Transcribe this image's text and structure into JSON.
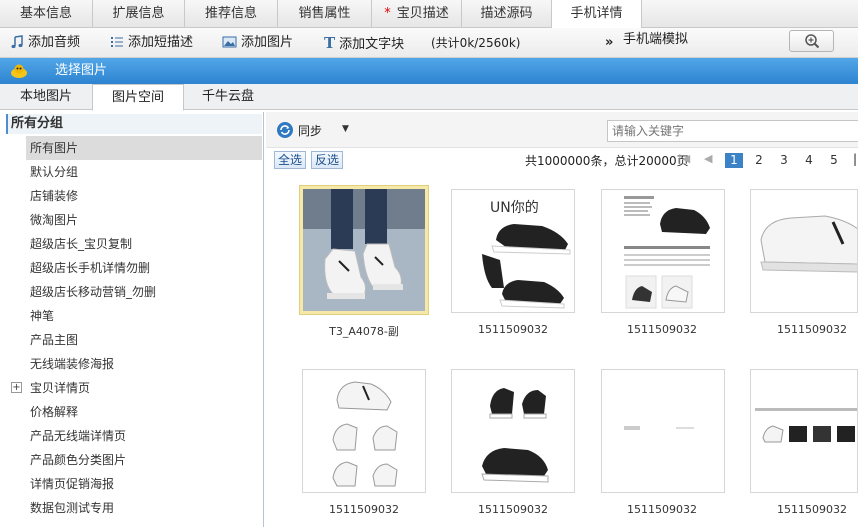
{
  "top_tabs": [
    {
      "label": "基本信息",
      "required": false
    },
    {
      "label": "扩展信息",
      "required": false
    },
    {
      "label": "推荐信息",
      "required": false
    },
    {
      "label": "销售属性",
      "required": false
    },
    {
      "label": "宝贝描述",
      "required": true
    },
    {
      "label": "描述源码",
      "required": false
    },
    {
      "label": "手机详情",
      "required": false
    }
  ],
  "toolbar": {
    "add_audio": "添加音频",
    "add_short_desc": "添加短描述",
    "add_image": "添加图片",
    "add_text_block": "添加文字块",
    "size_info": "(共计0k/2560k)",
    "more": "»",
    "mobile_preview": "手机端模拟"
  },
  "dialog": {
    "title": "选择图片"
  },
  "source_tabs": [
    "本地图片",
    "图片空间",
    "千牛云盘"
  ],
  "sidebar": {
    "header": "所有分组",
    "items": [
      "所有图片",
      "默认分组",
      "店铺装修",
      "微淘图片",
      "超级店长_宝贝复制",
      "超级店长手机详情勿删",
      "超级店长移动营销_勿删",
      "神笔",
      "产品主图",
      "无线端装修海报",
      "宝贝详情页",
      "价格解释",
      "产品无线端详情页",
      "产品颜色分类图片",
      "详情页促销海报",
      "数据包测试专用"
    ],
    "expander": "+"
  },
  "main": {
    "sync_label": "同步",
    "search_placeholder": "请输入关键字",
    "select_all": "全选",
    "invert_select": "反选",
    "total_info": "共1000000条，总计20000页",
    "pages": [
      "1",
      "2",
      "3",
      "4",
      "5"
    ],
    "current_page": "1"
  },
  "images": [
    {
      "caption": "T3_A4078-副",
      "selected": true
    },
    {
      "caption": "1511509032",
      "selected": false
    },
    {
      "caption": "1511509032",
      "selected": false
    },
    {
      "caption": "1511509032",
      "selected": false
    },
    {
      "caption": "1511509032",
      "selected": false
    },
    {
      "caption": "1511509032",
      "selected": false
    },
    {
      "caption": "1511509032",
      "selected": false
    },
    {
      "caption": "1511509032",
      "selected": false
    }
  ],
  "brand_text": "UN你的",
  "colors": {
    "accent": "#3b82c6",
    "title_bar": "#2d83d0",
    "selected_border": "#f6e9a8"
  }
}
